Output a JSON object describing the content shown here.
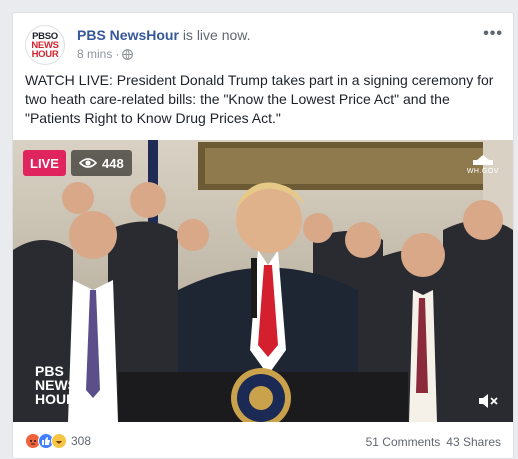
{
  "post": {
    "page_name": "PBS NewsHour",
    "status": "is live now.",
    "time": "8 mins",
    "separator": "·",
    "privacy_icon": "globe-icon",
    "more_label": "•••",
    "text": "WATCH LIVE: President Donald Trump takes part in a signing ceremony for two heath care-related bills: the \"Know the Lowest Price Act\" and the \"Patients Right to Know Drug Prices Act.\""
  },
  "avatar": {
    "line1": "PBSO",
    "line2": "NEWS",
    "line3": "HOUR"
  },
  "video": {
    "live_label": "LIVE",
    "viewer_count": "448",
    "viewer_icon": "eye-icon",
    "source_label": "WH.GOV",
    "watermark_line1": "PBS",
    "watermark_line2": "NEWS",
    "watermark_line3": "HOUR",
    "mute_icon": "speaker-muted-icon"
  },
  "footer": {
    "reaction_icons": [
      "angry-icon",
      "like-icon",
      "haha-icon"
    ],
    "reaction_count": "308",
    "comments": "51 Comments",
    "shares": "43 Shares"
  },
  "colors": {
    "link": "#365899",
    "live_red": "#e0245e",
    "muted_text": "#616770",
    "background": "#e9ebee"
  }
}
